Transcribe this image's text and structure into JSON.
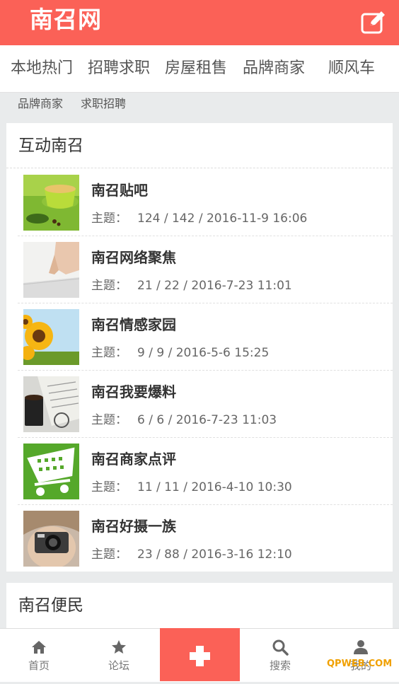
{
  "header": {
    "logo": "南召网",
    "accent": "#fb6157"
  },
  "nav": {
    "items": [
      {
        "label": "本地热门"
      },
      {
        "label": "招聘求职"
      },
      {
        "label": "房屋租售"
      },
      {
        "label": "品牌商家"
      },
      {
        "label": "顺风车"
      }
    ]
  },
  "subnav": {
    "items": [
      {
        "label": "品牌商家"
      },
      {
        "label": "求职招聘"
      }
    ]
  },
  "section1": {
    "title": "互动南召",
    "meta_label": "主题：",
    "rows": [
      {
        "title": "南召贴吧",
        "stats": "124 / 142 / 2016-11-9 16:06",
        "icon": "tea-image"
      },
      {
        "title": "南召网络聚焦",
        "stats": "21 / 22 / 2016-7-23 11:01",
        "icon": "hand-touch-image"
      },
      {
        "title": "南召情感家园",
        "stats": "9 / 9 / 2016-5-6 15:25",
        "icon": "sunflower-image"
      },
      {
        "title": "南召我要爆料",
        "stats": "6 / 6 / 2016-7-23 11:03",
        "icon": "coffee-newspaper-image"
      },
      {
        "title": "南召商家点评",
        "stats": "11 / 11 / 2016-4-10 10:30",
        "icon": "shopping-cart-image"
      },
      {
        "title": "南召好摄一族",
        "stats": "23 / 88 / 2016-3-16 12:10",
        "icon": "camera-girl-image"
      }
    ]
  },
  "section2": {
    "title": "南召便民"
  },
  "tabbar": {
    "items": [
      {
        "label": "首页",
        "icon": "home-icon"
      },
      {
        "label": "论坛",
        "icon": "star-icon"
      },
      {
        "label": "",
        "icon": "plus-icon"
      },
      {
        "label": "搜索",
        "icon": "search-icon"
      },
      {
        "label": "我的",
        "icon": "user-icon"
      }
    ]
  },
  "watermark": "QPWEB.COM"
}
